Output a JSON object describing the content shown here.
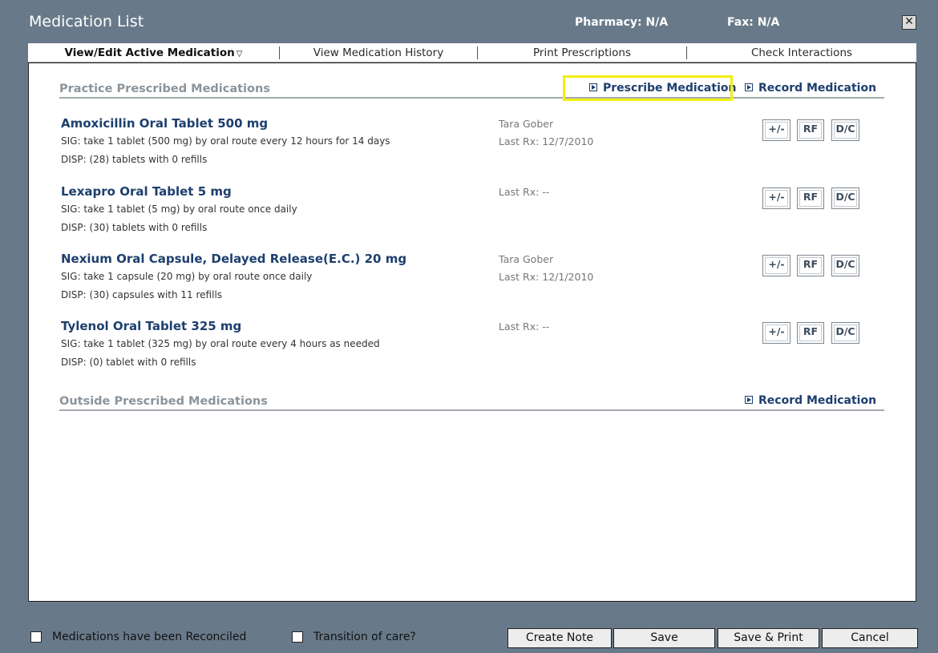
{
  "window": {
    "title": "Medication List",
    "pharmacy": "Pharmacy: N/A",
    "fax": "Fax: N/A",
    "close_glyph": "✕"
  },
  "tabs": [
    {
      "label": "View/Edit Active Medication",
      "active": true,
      "dropdown_glyph": "▽"
    },
    {
      "label": "View Medication History",
      "active": false
    },
    {
      "label": "Print Prescriptions",
      "active": false
    },
    {
      "label": "Check Interactions",
      "active": false
    }
  ],
  "practice_section": {
    "title": "Practice Prescribed Medications",
    "prescribe_link": "Prescribe Medication",
    "record_link": "Record Medication",
    "highlight_color": "#f2ef10"
  },
  "medications": [
    {
      "name": "Amoxicillin Oral Tablet 500 mg",
      "sig": "SIG: take 1 tablet (500 mg) by oral route every 12 hours for 14 days",
      "disp": "DISP: (28) tablets with 0 refills",
      "prescriber": "Tara Gober",
      "last_rx": "Last Rx: 12/7/2010"
    },
    {
      "name": "Lexapro Oral Tablet 5 mg",
      "sig": "SIG: take 1 tablet (5 mg) by oral route once daily",
      "disp": "DISP: (30) tablets with 0 refills",
      "prescriber": "",
      "last_rx": "Last Rx: --"
    },
    {
      "name": "Nexium Oral Capsule, Delayed Release(E.C.) 20 mg",
      "sig": "SIG: take 1 capsule (20 mg) by oral route once daily",
      "disp": "DISP: (30) capsules with 11 refills",
      "prescriber": "Tara Gober",
      "last_rx": "Last Rx: 12/1/2010"
    },
    {
      "name": "Tylenol Oral Tablet 325 mg",
      "sig": "SIG: take 1 tablet (325 mg) by oral route every 4 hours as needed",
      "disp": "DISP: (0) tablet with 0 refills",
      "prescriber": "",
      "last_rx": "Last Rx: --"
    }
  ],
  "row_buttons": {
    "adjust": "+/-",
    "refill": "RF",
    "discontinue": "D/C"
  },
  "outside_section": {
    "title": "Outside Prescribed Medications",
    "record_link": "Record Medication"
  },
  "footer": {
    "reconciled_label": "Medications have been Reconciled",
    "reconciled_checked": false,
    "transition_label": "Transition of care?",
    "transition_checked": false,
    "buttons": {
      "create_note": "Create Note",
      "save": "Save",
      "save_print": "Save & Print",
      "cancel": "Cancel"
    }
  }
}
